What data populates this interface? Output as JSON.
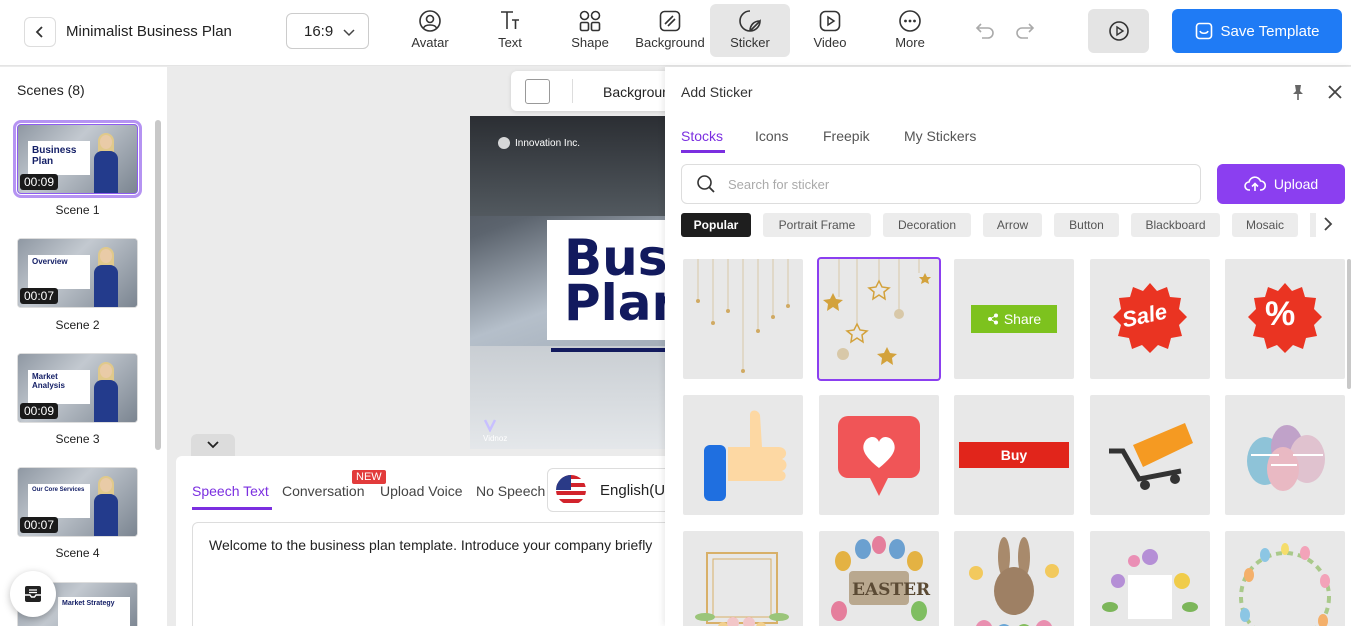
{
  "header": {
    "back_icon": "chevron-left-icon",
    "title": "Minimalist Business Plan",
    "ratio": "16:9",
    "tools": [
      {
        "label": "Avatar",
        "icon": "avatar-icon"
      },
      {
        "label": "Text",
        "icon": "text-icon"
      },
      {
        "label": "Shape",
        "icon": "shape-icon"
      },
      {
        "label": "Background",
        "icon": "background-icon"
      },
      {
        "label": "Sticker",
        "icon": "sticker-icon",
        "active": true
      },
      {
        "label": "Video",
        "icon": "video-icon"
      },
      {
        "label": "More",
        "icon": "more-icon"
      }
    ],
    "save_label": "Save Template",
    "accent": "#1f7bf5"
  },
  "scenes": {
    "title": "Scenes (8)",
    "items": [
      {
        "label": "Scene 1",
        "time": "00:09",
        "card_text": "Business Plan",
        "selected": true
      },
      {
        "label": "Scene 2",
        "time": "00:07",
        "card_text": "Overview"
      },
      {
        "label": "Scene 3",
        "time": "00:09",
        "card_text": "Market Analysis"
      },
      {
        "label": "Scene 4",
        "time": "00:07",
        "card_text": "Our Core Services"
      },
      {
        "label": "",
        "time": "",
        "card_text": "Market Strategy"
      }
    ]
  },
  "canvas": {
    "toolbar_background_label": "Background",
    "brand": "Innovation Inc.",
    "headline_line1": "Business",
    "headline_line2": "Plan",
    "logo": "Vidnoz"
  },
  "speech": {
    "tabs": [
      "Speech Text",
      "Conversation",
      "Upload Voice",
      "No Speech"
    ],
    "active_tab": "Speech Text",
    "new_badge": "NEW",
    "language": "English(US)",
    "text": "Welcome to the business plan template. Introduce your company briefly"
  },
  "sticker_panel": {
    "title": "Add Sticker",
    "tabs": [
      "Stocks",
      "Icons",
      "Freepik",
      "My Stickers"
    ],
    "active_tab": "Stocks",
    "search_placeholder": "Search for sticker",
    "upload_label": "Upload",
    "upload_color": "#8b3ff0",
    "chips": [
      "Popular",
      "Portrait Frame",
      "Decoration",
      "Arrow",
      "Button",
      "Blackboard",
      "Mosaic"
    ],
    "active_chip": "Popular",
    "stickers": [
      {
        "name": "hanging-stars-gold",
        "label": ""
      },
      {
        "name": "hanging-stars-gold-2",
        "label": "",
        "selected": true
      },
      {
        "name": "share-button",
        "label": "Share"
      },
      {
        "name": "sale-badge",
        "label": "Sale"
      },
      {
        "name": "percent-badge",
        "label": "%"
      },
      {
        "name": "thumbs-up",
        "label": ""
      },
      {
        "name": "heart-bubble",
        "label": ""
      },
      {
        "name": "buy-button",
        "label": "Buy"
      },
      {
        "name": "shopping-cart",
        "label": ""
      },
      {
        "name": "easter-eggs",
        "label": ""
      },
      {
        "name": "floral-frame",
        "label": ""
      },
      {
        "name": "easter-wreath",
        "label": "EASTER"
      },
      {
        "name": "easter-bunny",
        "label": ""
      },
      {
        "name": "flower-square-frame",
        "label": ""
      },
      {
        "name": "egg-wreath",
        "label": ""
      }
    ]
  }
}
